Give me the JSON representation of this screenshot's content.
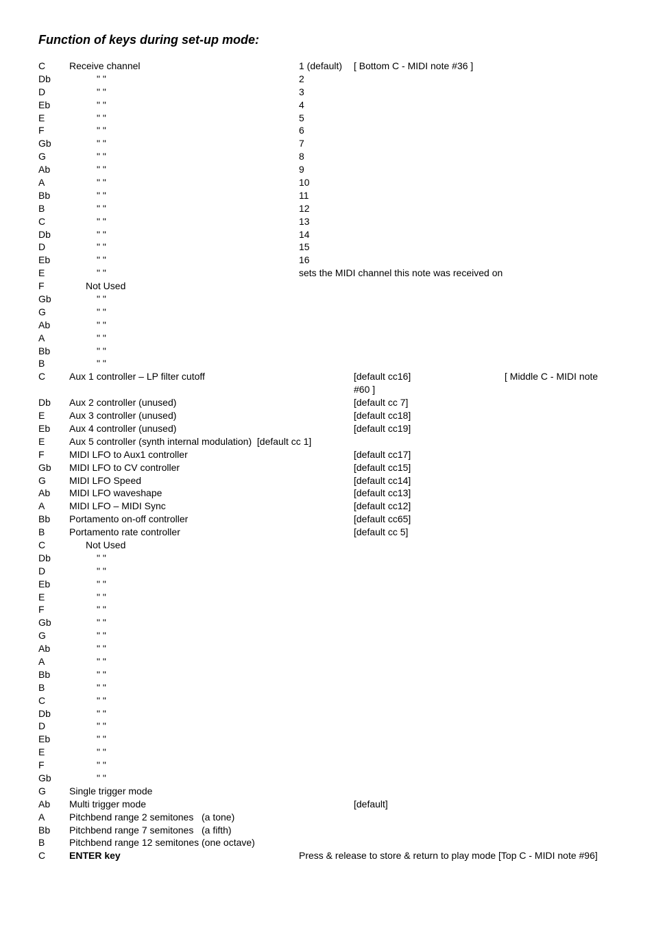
{
  "title": "Function of keys during set-up mode:",
  "rows": [
    {
      "key": "C",
      "func": "Receive channel",
      "val": "1 (default)",
      "extra": "[ Bottom C - MIDI note #36 ]"
    },
    {
      "key": "Db",
      "func": "\" \"",
      "ditto": true,
      "val": "2"
    },
    {
      "key": "D",
      "func": "\" \"",
      "ditto": true,
      "val": "3"
    },
    {
      "key": "Eb",
      "func": "\" \"",
      "ditto": true,
      "val": "4"
    },
    {
      "key": "E",
      "func": "\" \"",
      "ditto": true,
      "val": "5"
    },
    {
      "key": "F",
      "func": "\" \"",
      "ditto": true,
      "val": "6"
    },
    {
      "key": "Gb",
      "func": "\" \"",
      "ditto": true,
      "val": "7"
    },
    {
      "key": "G",
      "func": "\" \"",
      "ditto": true,
      "val": "8"
    },
    {
      "key": "Ab",
      "func": "\" \"",
      "ditto": true,
      "val": "9"
    },
    {
      "key": "A",
      "func": "\" \"",
      "ditto": true,
      "val": "10"
    },
    {
      "key": "Bb",
      "func": "\" \"",
      "ditto": true,
      "val": "11"
    },
    {
      "key": "B",
      "func": "\" \"",
      "ditto": true,
      "val": "12"
    },
    {
      "key": "C",
      "func": "\" \"",
      "ditto": true,
      "val": "13"
    },
    {
      "key": "Db",
      "func": "\" \"",
      "ditto": true,
      "val": "14"
    },
    {
      "key": "D",
      "func": "\" \"",
      "ditto": true,
      "val": "15"
    },
    {
      "key": "Eb",
      "func": "\" \"",
      "ditto": true,
      "val": "16"
    },
    {
      "key": "E",
      "func": "\" \"",
      "ditto": true,
      "val": "sets the MIDI channel this note was received on",
      "valspan": true
    },
    {
      "key": "F",
      "func": "Not Used",
      "indent": true
    },
    {
      "key": "Gb",
      "func": "\" \"",
      "ditto": true
    },
    {
      "key": "G",
      "func": "\" \"",
      "ditto": true
    },
    {
      "key": "Ab",
      "func": "\" \"",
      "ditto": true
    },
    {
      "key": "A",
      "func": "\" \"",
      "ditto": true
    },
    {
      "key": "Bb",
      "func": "\" \"",
      "ditto": true
    },
    {
      "key": "B",
      "func": "\" \"",
      "ditto": true
    },
    {
      "key": "C",
      "func": "Aux 1 controller – LP filter cutoff",
      "val2": "[default cc16]",
      "extra": "[ Middle C - MIDI note #60 ]"
    },
    {
      "key": "Db",
      "func": "Aux 2 controller (unused)",
      "val2": "[default cc  7]"
    },
    {
      "key": "E",
      "func": "Aux 3 controller (unused)",
      "val2": "[default cc18]"
    },
    {
      "key": "Eb",
      "func": "Aux 4 controller (unused)",
      "val2": "[default cc19]"
    },
    {
      "key": "E",
      "func": "Aux 5 controller (synth internal modulation)  [default cc 1]",
      "funcspan": true
    },
    {
      "key": "F",
      "func": "MIDI LFO to Aux1 controller",
      "val2": "[default cc17]"
    },
    {
      "key": "Gb",
      "func": "MIDI LFO to CV controller",
      "val2": "[default cc15]"
    },
    {
      "key": "G",
      "func": "MIDI LFO Speed",
      "val2": "[default cc14]"
    },
    {
      "key": "Ab",
      "func": "MIDI LFO waveshape",
      "val2": "[default cc13]"
    },
    {
      "key": "A",
      "func": "MIDI LFO – MIDI Sync",
      "val2": "[default cc12]"
    },
    {
      "key": "Bb",
      "func": "Portamento on-off controller",
      "val2": "[default cc65]"
    },
    {
      "key": "B",
      "func": "Portamento rate controller",
      "val2": "[default cc  5]"
    },
    {
      "key": "C",
      "func": "Not Used",
      "indent": true
    },
    {
      "key": "Db",
      "func": "\" \"",
      "ditto": true
    },
    {
      "key": "D",
      "func": "\" \"",
      "ditto": true
    },
    {
      "key": "Eb",
      "func": "\" \"",
      "ditto": true
    },
    {
      "key": "E",
      "func": "\" \"",
      "ditto": true
    },
    {
      "key": "F",
      "func": "\" \"",
      "ditto": true
    },
    {
      "key": "Gb",
      "func": "\" \"",
      "ditto": true
    },
    {
      "key": "G",
      "func": "\" \"",
      "ditto": true
    },
    {
      "key": "Ab",
      "func": "\" \"",
      "ditto": true
    },
    {
      "key": "A",
      "func": "\" \"",
      "ditto": true
    },
    {
      "key": "Bb",
      "func": "\" \"",
      "ditto": true
    },
    {
      "key": "B",
      "func": "\" \"",
      "ditto": true
    },
    {
      "key": "C",
      "func": "\" \"",
      "ditto": true
    },
    {
      "key": "Db",
      "func": "\" \"",
      "ditto": true
    },
    {
      "key": "D",
      "func": "\" \"",
      "ditto": true
    },
    {
      "key": "Eb",
      "func": "\" \"",
      "ditto": true
    },
    {
      "key": "E",
      "func": "\" \"",
      "ditto": true
    },
    {
      "key": "F",
      "func": "\" \"",
      "ditto": true
    },
    {
      "key": "Gb",
      "func": "\" \"",
      "ditto": true
    },
    {
      "key": "G",
      "func": "Single trigger mode"
    },
    {
      "key": "Ab",
      "func": "Multi trigger  mode",
      "val2": "[default]"
    },
    {
      "key": "A",
      "func": "Pitchbend range 2 semitones   (a tone)",
      "funcspan": true
    },
    {
      "key": "Bb",
      "func": "Pitchbend range 7 semitones   (a fifth)",
      "funcspan": true
    },
    {
      "key": "B",
      "func": "Pitchbend range 12 semitones (one octave)",
      "funcspan": true
    },
    {
      "key": "C",
      "func": "ENTER key",
      "bold": true,
      "val": "Press & release to store & return to play mode [Top C - MIDI note #96]",
      "valspan": true
    }
  ]
}
